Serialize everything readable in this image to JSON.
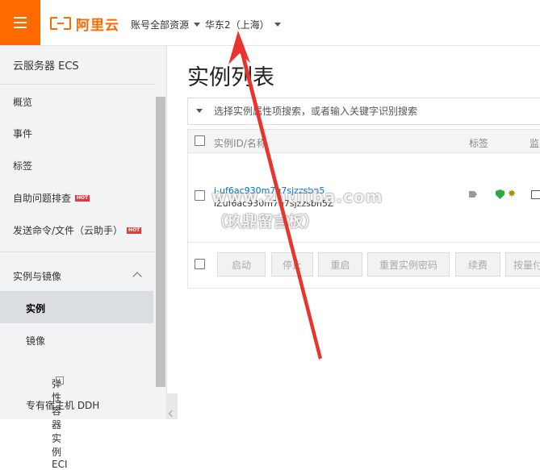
{
  "topbar": {
    "brand": "阿里云",
    "account_scope": "账号全部资源",
    "region": "华东2（上海）"
  },
  "sidebar": {
    "title": "云服务器 ECS",
    "items": [
      {
        "label": "概览"
      },
      {
        "label": "事件"
      },
      {
        "label": "标签"
      },
      {
        "label": "自助问题排查",
        "badge": "HOT"
      },
      {
        "label": "发送命令/文件（云助手）",
        "badge": "HOT"
      }
    ],
    "section": {
      "label": "实例与镜像",
      "children": [
        {
          "label": "实例",
          "active": true
        },
        {
          "label": "镜像"
        },
        {
          "label": "弹性容器实例 ECI"
        },
        {
          "label": "专有宿主机 DDH"
        }
      ]
    }
  },
  "main": {
    "title": "实例列表",
    "search_placeholder": "选择实例属性项搜索，或者输入关键字识别搜索",
    "table": {
      "columns": [
        "实例ID/名称",
        "标签",
        "监"
      ],
      "rows": [
        {
          "id": "i-uf6ac930m7q7sjzzsbn5",
          "name": "iZuf6ac930m7q7sjzzsbn5Z"
        }
      ]
    },
    "actions": [
      "启动",
      "停止",
      "重启",
      "重置实例密码",
      "续费",
      "按量付"
    ]
  },
  "watermark": {
    "line1": "www.zhujiba.com",
    "line2": "（玖鼎留言板）"
  },
  "colors": {
    "brand_orange": "#ff6a00",
    "link_blue": "#0070cc",
    "hot_red": "#e4393c",
    "annotation_arrow": "#e8342c"
  }
}
